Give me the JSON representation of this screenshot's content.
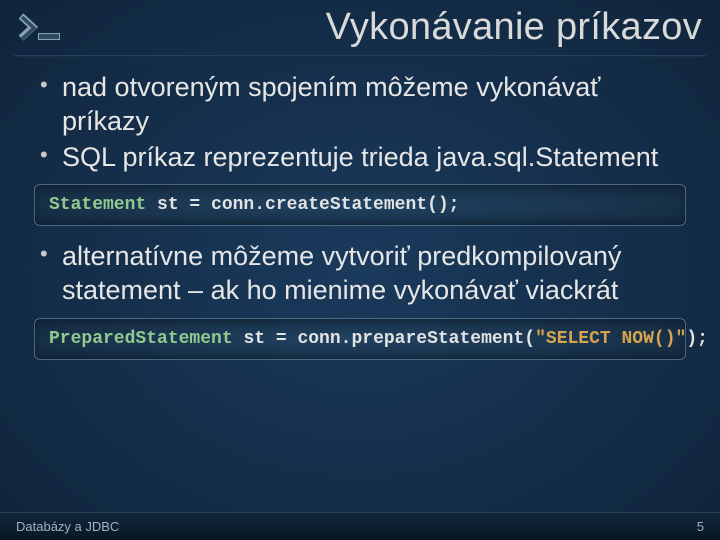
{
  "header": {
    "title": "Vykonávanie príkazov",
    "icon_name": "prompt-icon"
  },
  "bullets1": [
    "nad otvoreným spojením môžeme vykonávať príkazy",
    "SQL príkaz reprezentuje trieda java.sql.Statement"
  ],
  "code1": {
    "type": "Statement",
    "decl": " st = conn.createStatement();"
  },
  "bullets2": [
    "alternatívne môžeme vytvoriť predkompilovaný statement – ak ho mienime vykonávať viackrát"
  ],
  "code2": {
    "type": "PreparedStatement",
    "decl_a": " st = conn.prepareStatement(",
    "str": "\"SELECT NOW()\"",
    "decl_b": ");"
  },
  "footer": {
    "left": "Databázy a JDBC",
    "page": "5"
  }
}
